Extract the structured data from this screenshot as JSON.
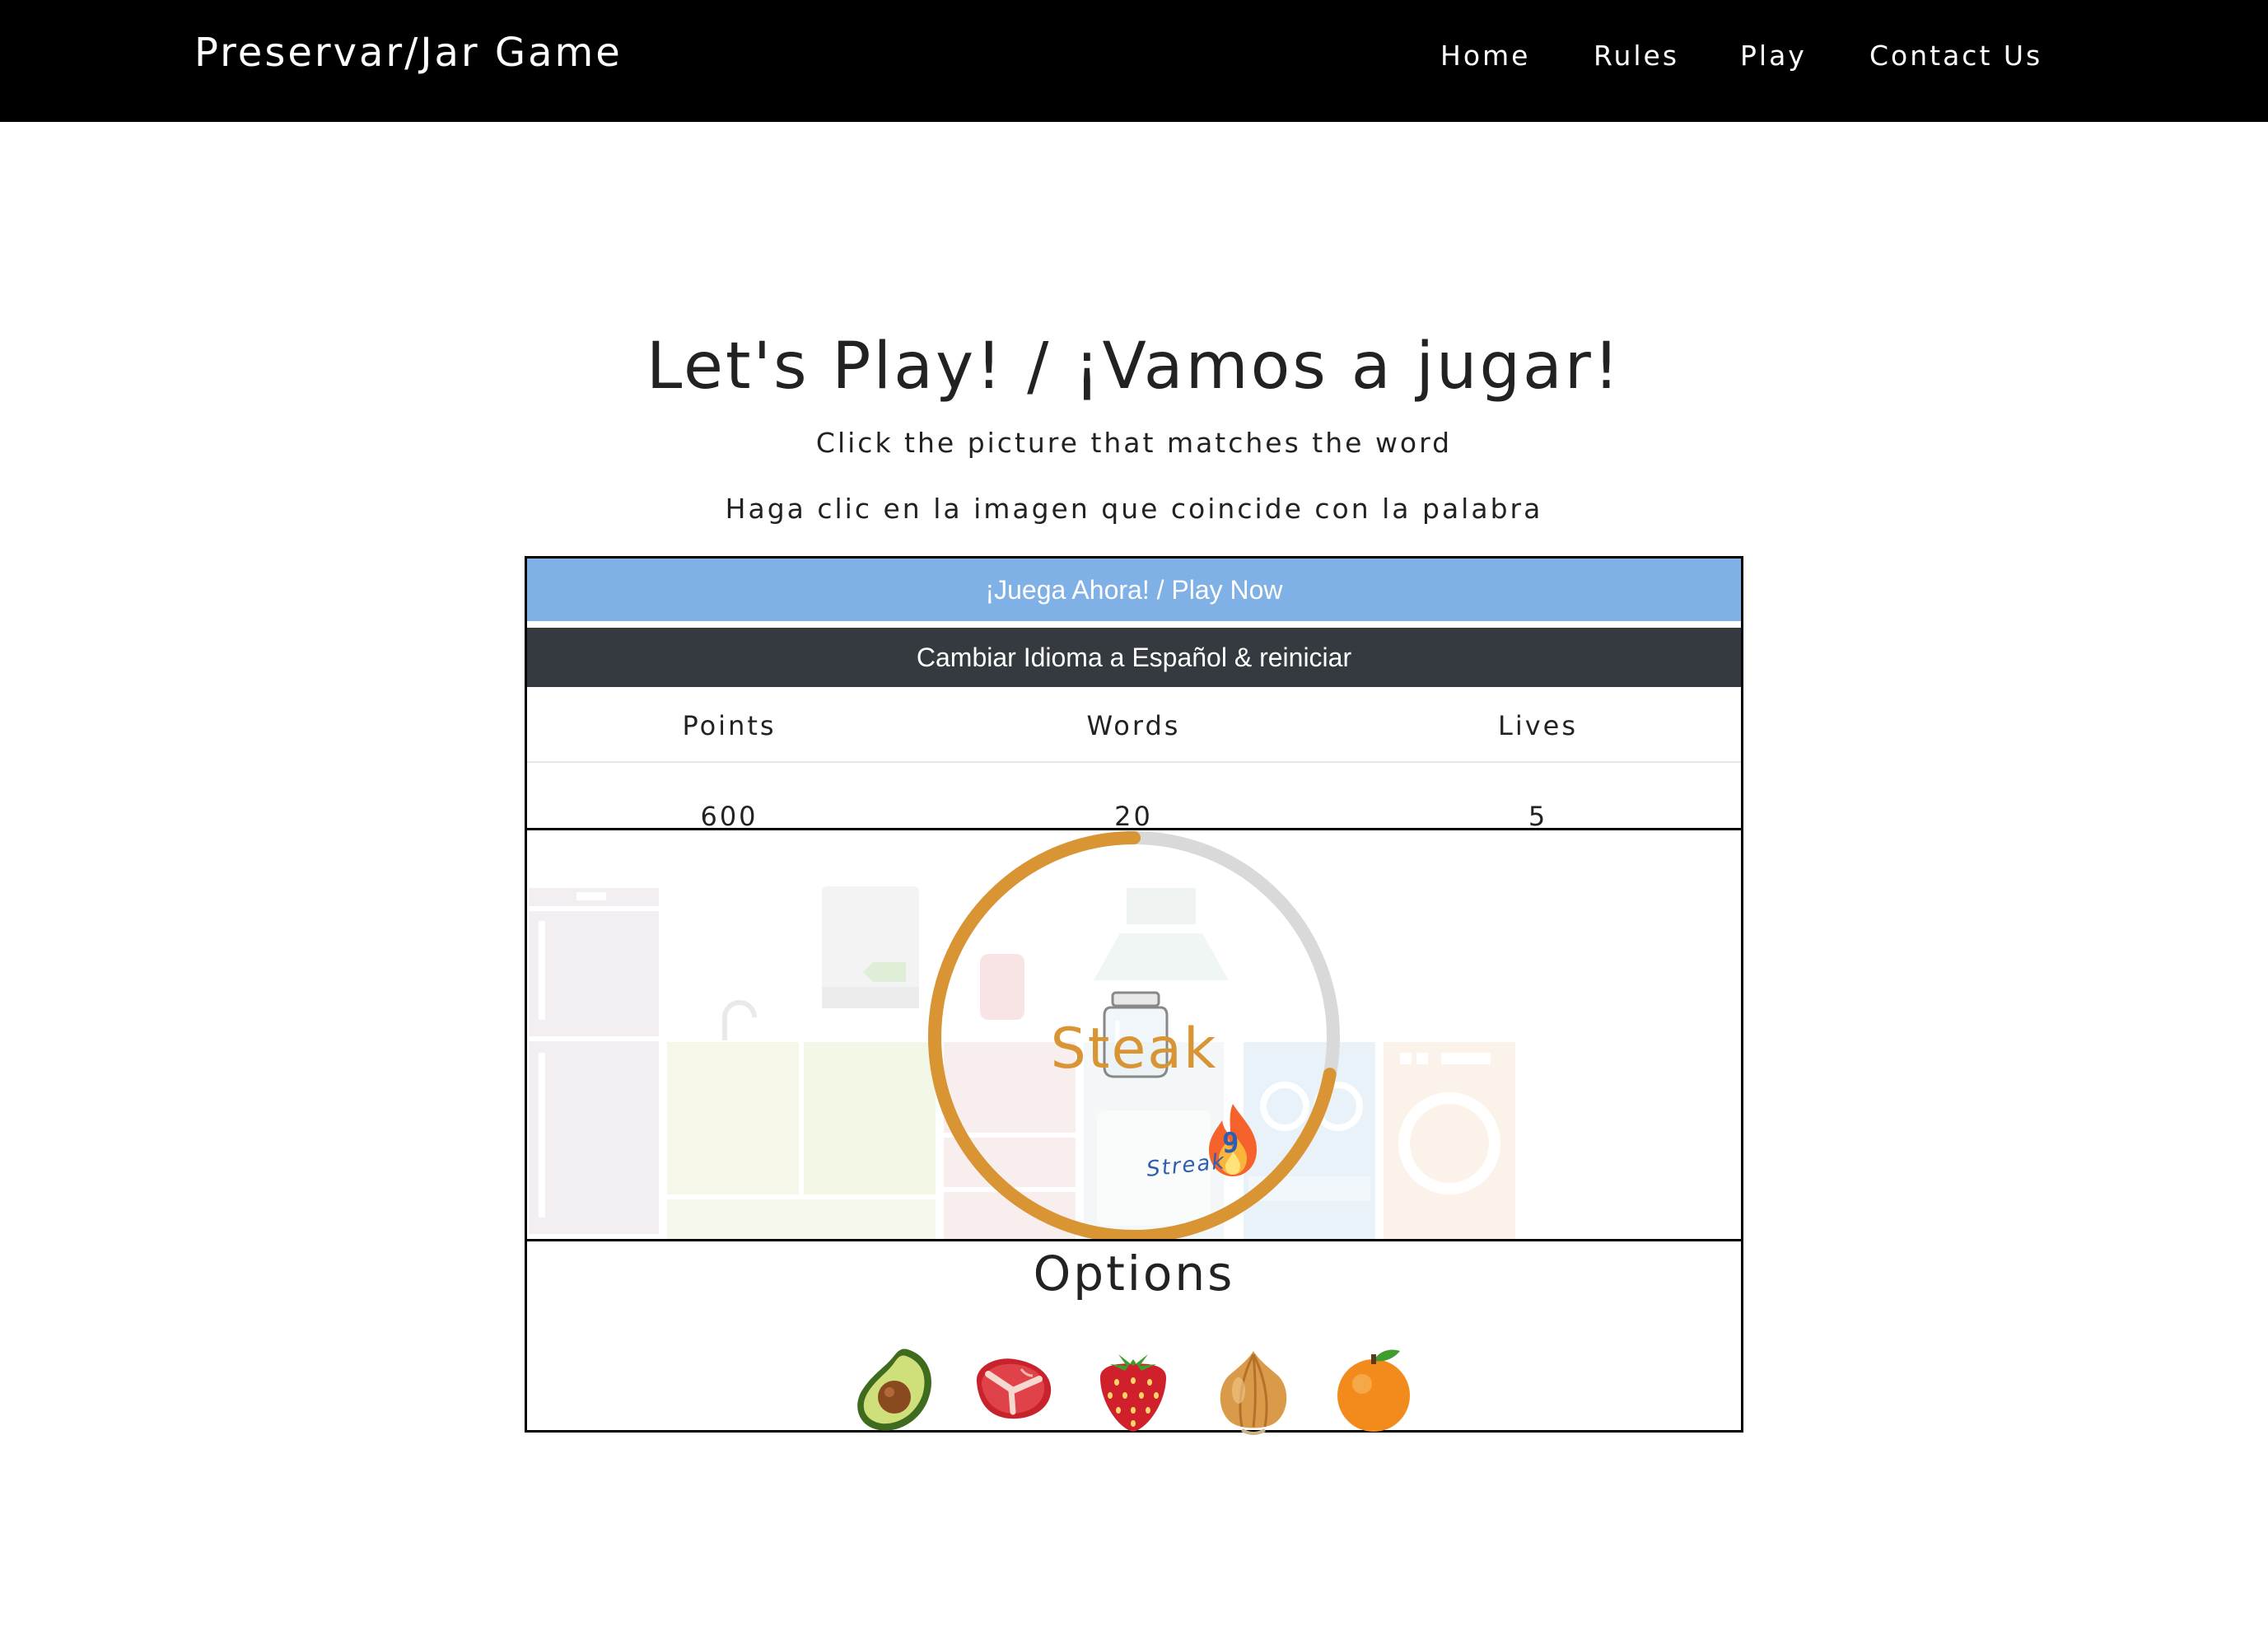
{
  "nav": {
    "brand": "Preservar/Jar Game",
    "links": [
      "Home",
      "Rules",
      "Play",
      "Contact Us"
    ]
  },
  "page": {
    "title": "Let's Play! / ¡Vamos a jugar!",
    "instruction_en": "Click the picture that matches the word",
    "instruction_es": "Haga clic en la imagen que coincide con la palabra"
  },
  "game": {
    "play_button": "¡Juega Ahora! / Play Now",
    "language_button": "Cambiar Idioma a Español & reiniciar",
    "stats": {
      "labels": [
        "Points",
        "Words",
        "Lives"
      ],
      "values": [
        "600",
        "20",
        "5"
      ]
    },
    "current_word": "Steak",
    "timer_progress": 0.72,
    "streak": {
      "count": "9",
      "label": "Streak"
    },
    "options_title": "Options",
    "options": [
      "avocado-icon",
      "steak-icon",
      "strawberry-icon",
      "onion-icon",
      "orange-icon"
    ]
  },
  "colors": {
    "accent": "#d99433",
    "play_button": "#7fb0e6",
    "language_button": "#353a40",
    "timer_track": "#d9d9d9"
  }
}
